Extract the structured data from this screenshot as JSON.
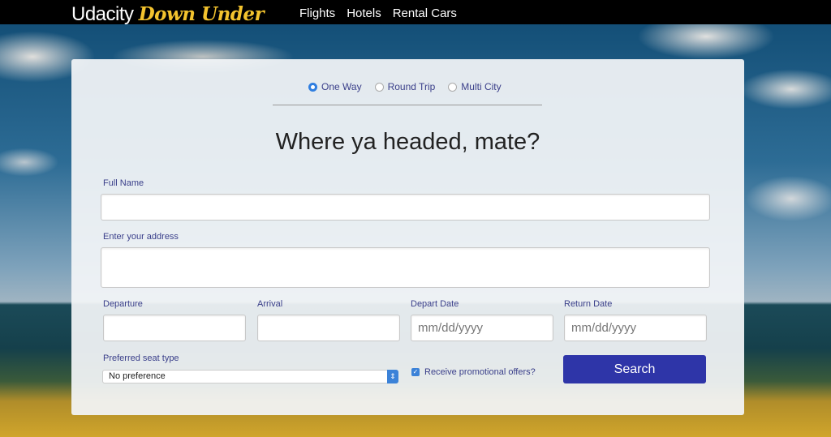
{
  "header": {
    "logo_main": "Udacity",
    "logo_accent": "Down Under",
    "nav": [
      "Flights",
      "Hotels",
      "Rental Cars"
    ]
  },
  "form": {
    "trip_types": [
      {
        "label": "One Way",
        "selected": true
      },
      {
        "label": "Round Trip",
        "selected": false
      },
      {
        "label": "Multi City",
        "selected": false
      }
    ],
    "heading": "Where ya headed, mate?",
    "full_name_label": "Full Name",
    "full_name_value": "",
    "address_label": "Enter your address",
    "address_value": "",
    "departure_label": "Departure",
    "arrival_label": "Arrival",
    "depart_date_label": "Depart Date",
    "depart_date_placeholder": "mm/dd/yyyy",
    "return_date_label": "Return Date",
    "return_date_placeholder": "mm/dd/yyyy",
    "seat_label": "Preferred seat type",
    "seat_value": "No preference",
    "promo_label": "Receive promotional offers?",
    "promo_checked": true,
    "search_label": "Search"
  },
  "colors": {
    "accent": "#2e35a8",
    "label": "#3a3f8a",
    "logo_accent": "#f3c32e"
  }
}
